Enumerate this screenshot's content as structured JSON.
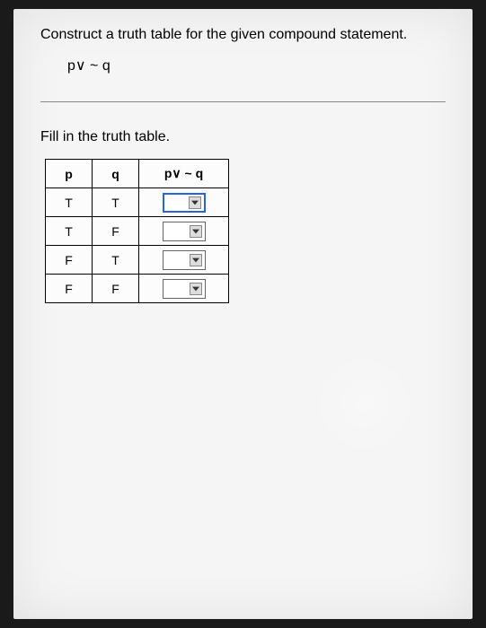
{
  "instruction": "Construct a truth table for the given compound statement.",
  "expression": "p∨ ~ q",
  "subinstruction": "Fill in the truth table.",
  "table": {
    "headers": [
      "p",
      "q",
      "p∨ ~ q"
    ],
    "rows": [
      {
        "p": "T",
        "q": "T",
        "result": "",
        "active": true
      },
      {
        "p": "T",
        "q": "F",
        "result": "",
        "active": false
      },
      {
        "p": "F",
        "q": "T",
        "result": "",
        "active": false
      },
      {
        "p": "F",
        "q": "F",
        "result": "",
        "active": false
      }
    ]
  }
}
